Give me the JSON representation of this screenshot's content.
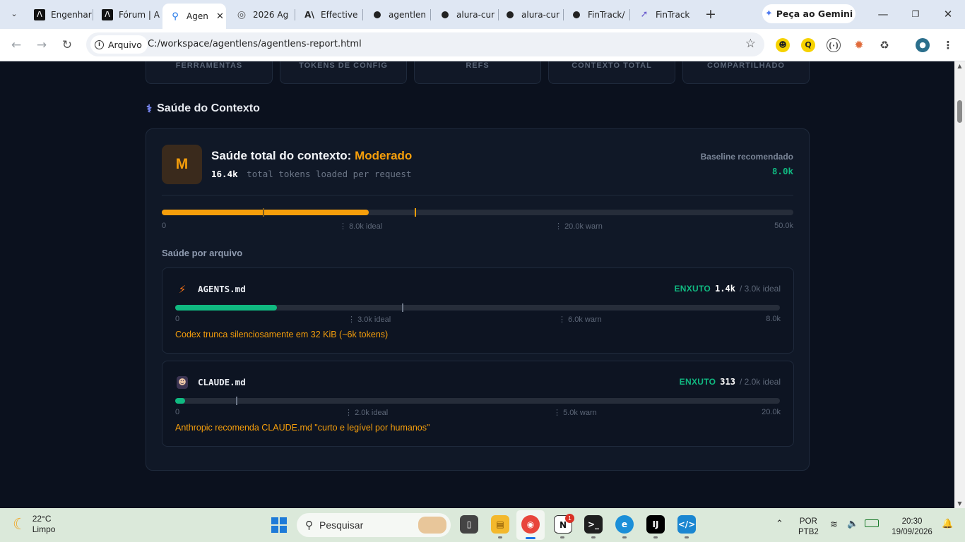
{
  "browser": {
    "tabs": [
      {
        "title": "Engenhar",
        "icon": "a-logo-icon"
      },
      {
        "title": "Fórum | A",
        "icon": "a-logo-icon"
      },
      {
        "title": "Agen",
        "icon": "search-icon",
        "active": true
      },
      {
        "title": "2026 Ag",
        "icon": "globe-icon"
      },
      {
        "title": "Effective",
        "icon": "anthropic-icon"
      },
      {
        "title": "agentlen",
        "icon": "github-icon"
      },
      {
        "title": "alura-cur",
        "icon": "github-icon"
      },
      {
        "title": "alura-cur",
        "icon": "github-icon"
      },
      {
        "title": "FinTrack/",
        "icon": "github-icon"
      },
      {
        "title": "FinTrack",
        "icon": "chart-icon"
      }
    ],
    "gemini_label": "Peça ao Gemini",
    "security_chip": "Arquivo",
    "url": "C:/workspace/agentlens/agentlens-report.html"
  },
  "report": {
    "stat_labels": [
      "FERRAMENTAS",
      "TOKENS DE CONFIG",
      "REFS",
      "CONTEXTO TOTAL",
      "COMPARTILHADO"
    ],
    "section_title": "Saúde do Contexto",
    "grade": "M",
    "health_title": "Saúde total do contexto:",
    "health_status": "Moderado",
    "total_tokens": "16.4k",
    "total_tokens_caption": "total tokens loaded per request",
    "baseline_label": "Baseline recomendado",
    "baseline_value": "8.0k",
    "overall_bar": {
      "fill_fraction": 0.328,
      "ideal_fraction": 0.16,
      "warn_fraction": 0.4,
      "labels": {
        "min": "0",
        "ideal": "8.0k ideal",
        "warn": "20.0k warn",
        "max": "50.0k"
      }
    },
    "per_file_title": "Saúde por arquivo",
    "files": [
      {
        "name": "AGENTS.md",
        "icon": "lightning-icon",
        "status": "ENXUTO",
        "value": "1.4k",
        "max_text": "/ 3.0k ideal",
        "fill_fraction": 0.168,
        "marker_fraction": 0.375,
        "labels": {
          "min": "0",
          "ideal": "3.0k ideal",
          "warn": "6.0k warn",
          "max": "8.0k"
        },
        "note": "Codex trunca silenciosamente em 32 KiB (~6k tokens)"
      },
      {
        "name": "CLAUDE.md",
        "icon": "claude-avatar-icon",
        "status": "ENXUTO",
        "value": "313",
        "max_text": "/ 2.0k ideal",
        "fill_fraction": 0.016,
        "marker_fraction": 0.1,
        "labels": {
          "min": "0",
          "ideal": "2.0k ideal",
          "warn": "5.0k warn",
          "max": "20.0k"
        },
        "note": "Anthropic recomenda CLAUDE.md \"curto e legível por humanos\""
      }
    ]
  },
  "taskbar": {
    "temperature": "22°C",
    "condition": "Limpo",
    "search_placeholder": "Pesquisar",
    "notion_badge": "1",
    "language": "POR",
    "layout": "PTB2",
    "time": "20:30",
    "date": "19/09/2026"
  },
  "colors": {
    "accent_orange": "#f59e0b",
    "accent_green": "#10b981",
    "page_bg": "#0b111e"
  }
}
